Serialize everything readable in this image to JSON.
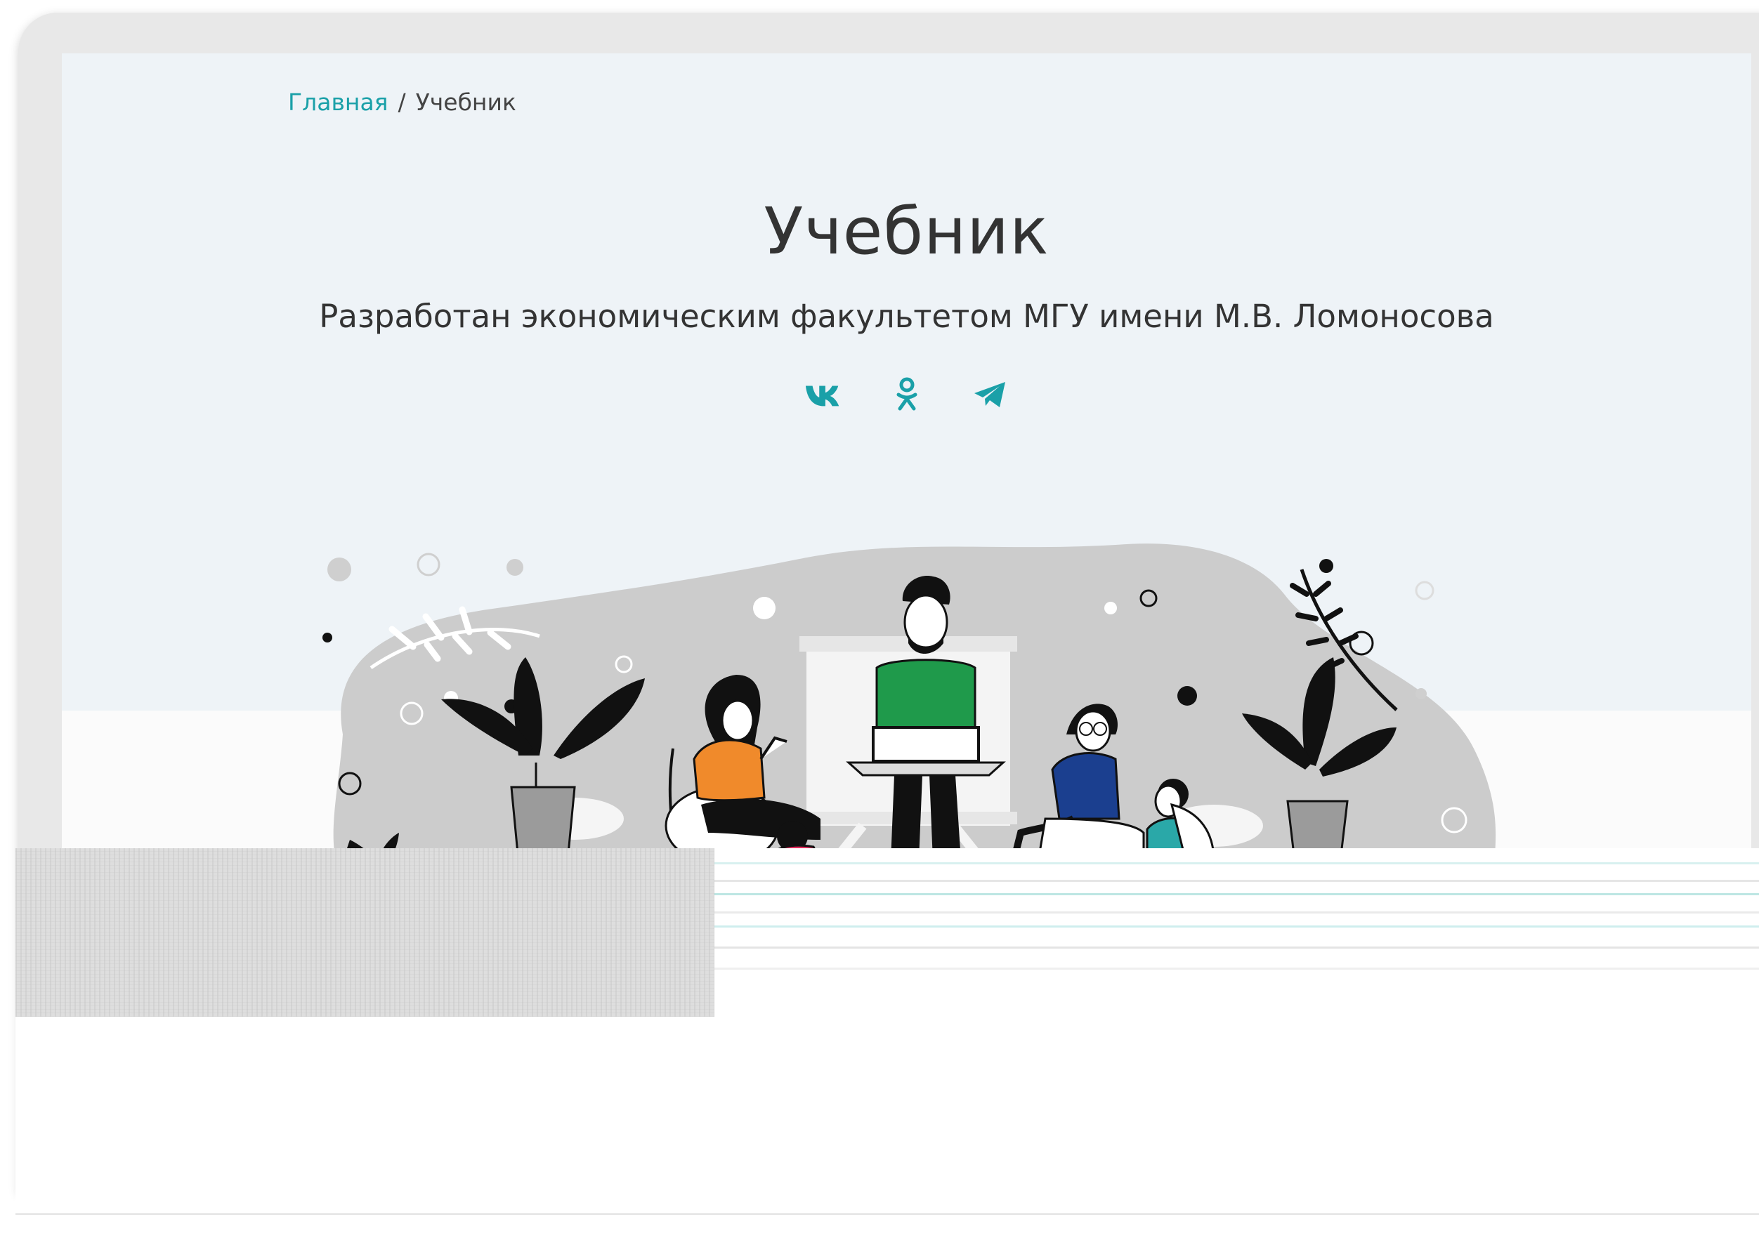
{
  "breadcrumb": {
    "home_label": "Главная",
    "separator": "/",
    "current_label": "Учебник"
  },
  "header": {
    "title": "Учебник",
    "subtitle": "Разработан экономическим факультетом МГУ имени М.В. Ломоносова"
  },
  "socials": [
    {
      "name": "vk-icon"
    },
    {
      "name": "odnoklassniki-icon"
    },
    {
      "name": "telegram-icon"
    }
  ],
  "colors": {
    "accent": "#1aa0a8",
    "page_background": "#eef3f7",
    "text": "#333333",
    "shirt_green": "#1f9a4b",
    "shirt_orange": "#f08a2b",
    "jacket_blue": "#1b3f8f",
    "shirt_teal": "#2aa8a8",
    "shirt_pink": "#e02a5b"
  }
}
